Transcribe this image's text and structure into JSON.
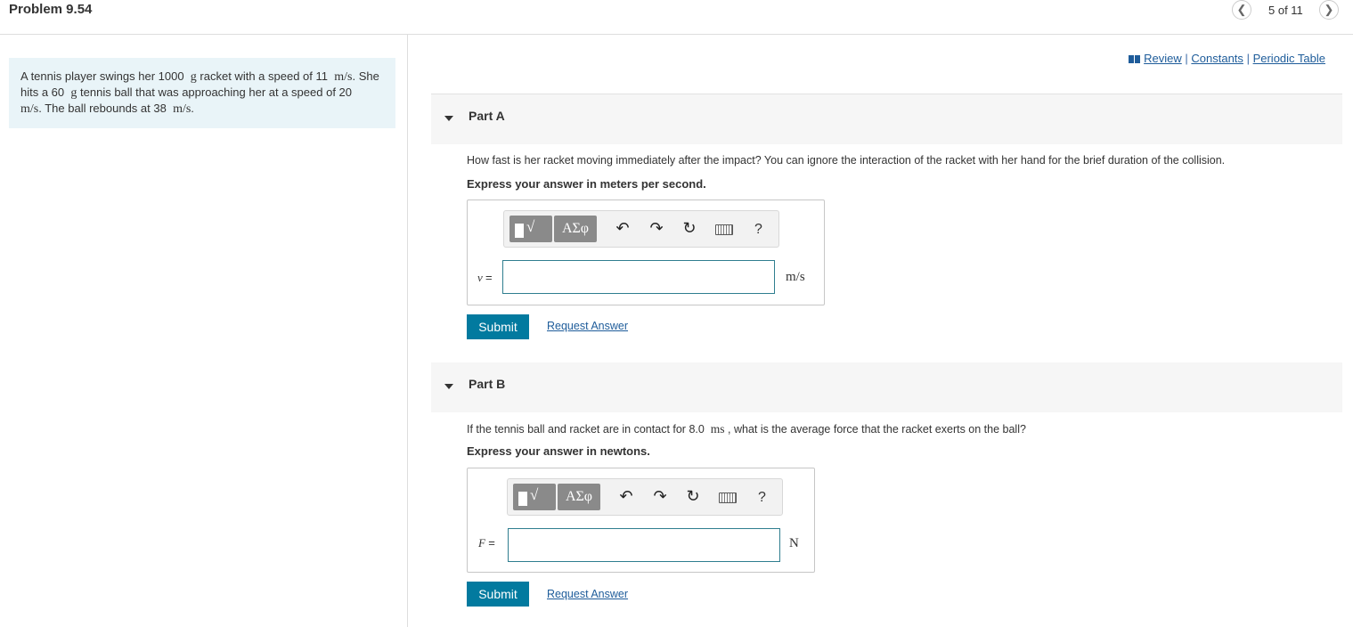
{
  "header": {
    "title": "Problem 9.54",
    "prev_icon": "chevron-left-icon",
    "next_icon": "chevron-right-icon",
    "page_counter": "5 of 11"
  },
  "problem": {
    "text_1": "A tennis player swings her 1000",
    "m_1": "g",
    "text_2": "racket with a speed of 11",
    "m_2": "m/s",
    "text_3": ". She hits a 60",
    "m_3": "g",
    "text_4": "tennis ball that was approaching her at a speed of 20",
    "m_4": "m/s",
    "text_5": ". The ball rebounds at 38",
    "m_5": "m/s",
    "text_6": "."
  },
  "links": {
    "review": "Review",
    "constants": "Constants",
    "periodic_table": "Periodic Table",
    "separator": "|"
  },
  "parts": {
    "a": {
      "label": "Part A",
      "question": "How fast is her racket moving immediately after the impact? You can ignore the interaction of the racket with her hand for the brief duration of the collision.",
      "instruction": "Express your answer in meters per second.",
      "variable": "v",
      "equals": "=",
      "value": "",
      "unit": "m/s",
      "submit": "Submit",
      "request": "Request Answer"
    },
    "b": {
      "label": "Part B",
      "question_1": "If the tennis ball and racket are in contact for 8.0",
      "question_m": "ms",
      "question_2": ", what is the average force that the racket exerts on the ball?",
      "instruction": "Express your answer in newtons.",
      "variable": "F",
      "equals": "=",
      "value": "",
      "unit": "N",
      "submit": "Submit",
      "request": "Request Answer"
    }
  },
  "toolbar": {
    "templates_label": "ΑΣφ",
    "radical_label": "√",
    "undo_icon": "undo-icon",
    "redo_icon": "redo-icon",
    "reset_icon": "reset-icon",
    "keyboard_icon": "keyboard-icon",
    "help_label": "?"
  },
  "colors": {
    "accent": "#027a9f",
    "link": "#1e5c9a",
    "problem_bg": "#e9f4f8"
  }
}
